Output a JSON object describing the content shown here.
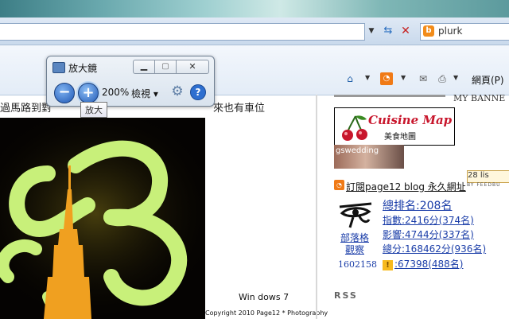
{
  "browser": {
    "search_engine_label": "plurk",
    "search_logo_letter": "b",
    "page_menu_label": "網頁(P)",
    "arrow_glyph": "▼"
  },
  "magnifier": {
    "title": "放大鏡",
    "zoom_level": "200%",
    "view_menu_label": "檢視 ▾",
    "zoom_out_glyph": "−",
    "zoom_in_glyph": "+",
    "help_glyph": "?",
    "tooltip": "放大"
  },
  "article": {
    "headline_left": "過馬路到對",
    "headline_right": "來也有車位",
    "photo_caption": "Win dows 7",
    "copyright": "Copyright 2010 Page12 * Photography"
  },
  "sidebar": {
    "banner_label": "MY BANNE",
    "cuisine_title": "Cuisine Map",
    "cuisine_subtitle": "美食地圖",
    "gswedding_label": "gswedding",
    "counter_text": "28 lis",
    "feed_label": "BY FEEDBU",
    "subscribe_link": "訂閱page12 blog 永久網址",
    "blog_ranking_label": "部落格觀察",
    "blog_count": "1602158",
    "stats": {
      "total_rank": "總排名:208名",
      "index": "指數:2416分(374名)",
      "impact": "影響:4744分(337名)",
      "score": "總分:168462分(936名)",
      "bonus_badge": "!",
      "bonus": ":67398(488名)"
    },
    "rss_label": "RSS"
  }
}
